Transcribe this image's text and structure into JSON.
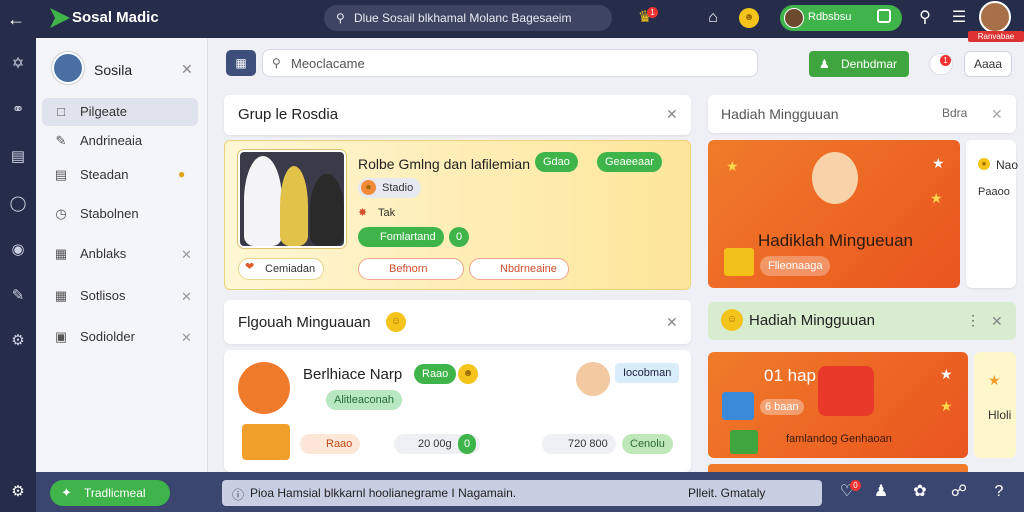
{
  "app": {
    "title": "Sosal Madic"
  },
  "topbar": {
    "search_text": "Dlue Sosail blkhamal Molanc Bagesaeim",
    "notif_count": "1",
    "user_name": "Rdbsbsu",
    "avatar_badge": "Ranvabae"
  },
  "sidebar": {
    "profile_name": "Sosila",
    "items": [
      {
        "label": "Pilgeate"
      },
      {
        "label": "Andrineaia"
      },
      {
        "label": "Steadan"
      },
      {
        "label": "Stabolnen"
      },
      {
        "label": "Anblaks"
      },
      {
        "label": "Sotlisos"
      },
      {
        "label": "Sodiolder"
      }
    ]
  },
  "toolbar": {
    "search_placeholder": "Meoclacame",
    "green_button": "Denbdmar",
    "notif_count": "1",
    "outline_button": "Aaaa"
  },
  "group_card": {
    "title": "Grup le Rosdia",
    "headline": "Rolbe Gmlng dan lafilemian",
    "pill1": "Gdao",
    "pill2": "Geaeeaar",
    "tag1": "Stadio",
    "meta": "Tak",
    "pill3": "Fomlartand",
    "pill4": "0",
    "location": "Cemiadan",
    "btn1": "Befnorn",
    "btn2": "Nbdrneaine"
  },
  "weekly_card": {
    "title": "Flgouah Minguauan",
    "person_name": "Berlhiace Narp",
    "person_pill": "Raao",
    "person_tag": "Alitleaconah",
    "right_tag": "Iocobman",
    "stat1": "Raao",
    "stat2": "20 00g",
    "stat2_badge": "0",
    "stat3": "720 800",
    "stat4": "Cenolu"
  },
  "reward_panel": {
    "title": "Hadiah Mingguuan",
    "action": "Bdra",
    "banner_title": "Hadiklah Mingueuan",
    "banner_sub": "Flleonaaga",
    "side_title": "Nao",
    "side_sub": "Paaoo"
  },
  "reward_panel2": {
    "title": "Hadiah Mingguuan",
    "banner_title": "01 hap",
    "banner_sub": "6 baan",
    "banner_caption": "famlandog Genhaoan",
    "side_title": "Hloli"
  },
  "bottombar": {
    "green_label": "Tradlicmeal",
    "status_text": "Pioa Hamsial blkkarnl hoolianegrame I Nagamain.",
    "status_right": "Plleit. Gmataly",
    "notif_count": "0"
  }
}
